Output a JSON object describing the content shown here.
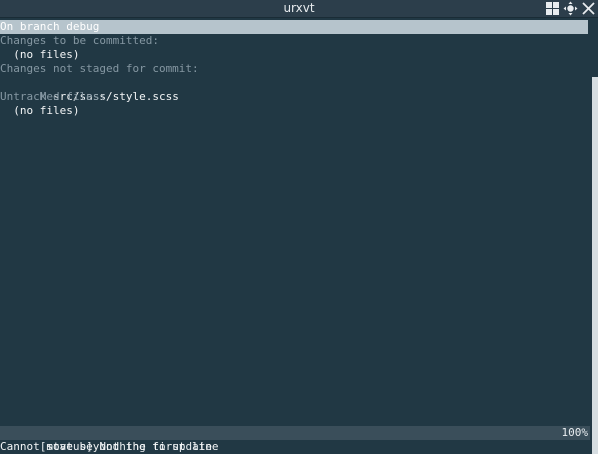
{
  "window": {
    "title": "urxvt",
    "buttons": {
      "tile_icon": "grid-icon",
      "move_icon": "move-arrows-icon",
      "close_icon": "close-icon"
    }
  },
  "terminal": {
    "branch_line": "On branch debug",
    "staged_header": "Changes to be committed:",
    "staged_files": "  (no files)",
    "unstaged_header": "Changes not staged for commit:",
    "unstaged_entries": [
      {
        "flag": "M",
        "path": " src/sass/style.scss"
      }
    ],
    "untracked_header": "Untracked files:",
    "untracked_files": "  (no files)"
  },
  "statusbar": {
    "left": "[status] Nothing to update",
    "right": "100%"
  },
  "message_line": "Cannot move beyond the first line",
  "colors": {
    "background": "#213844",
    "cursor_line": "#b6c4cc",
    "dim_text": "#8597a2",
    "statusbar_bg": "#3a4e5a"
  }
}
